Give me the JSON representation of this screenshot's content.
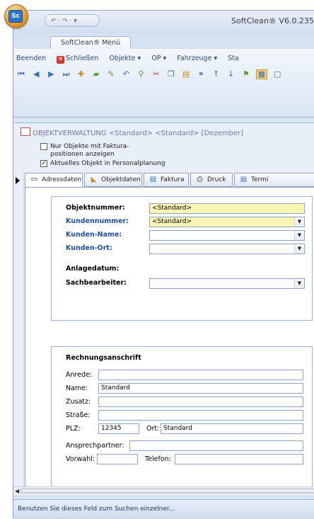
{
  "app": {
    "title": "SoftClean® V6.0.235",
    "quick_access": "↶ · ↷ · ▾",
    "orb_label": "Sc"
  },
  "ribbon": {
    "tab": "SoftClean® Menü",
    "menu": [
      "Beenden",
      "Schließen",
      "Objekte ▾",
      "OP ▾",
      "Fahrzeuge ▾",
      "Sta"
    ]
  },
  "document": {
    "title": "OBJEKTVERWALTUNG  <Standard>  <Standard>  [Dezember]",
    "checkbox1_line1": "Nur Objekte mit Faktura-",
    "checkbox1_line2": "positionen anzeigen",
    "checkbox1_checked": false,
    "checkbox2": "Aktuelles Objekt in Personalplanung",
    "checkbox2_checked": true
  },
  "tabs": [
    "Adressdaten",
    "Objektdaten",
    "Faktura",
    "Druck",
    "Termi"
  ],
  "form": {
    "objektnummer_label": "Objektnummer:",
    "objektnummer_value": "<Standard>",
    "kundennummer_label": "Kundennummer:",
    "kundennummer_value": "<Standard>",
    "kunden_name_label": "Kunden-Name:",
    "kunden_ort_label": "Kunden-Ort:",
    "anlagedatum_label": "Anlagedatum:",
    "sachbearbeiter_label": "Sachbearbeiter:"
  },
  "billing": {
    "heading": "Rechnungsanschrift",
    "anrede_label": "Anrede:",
    "name_label": "Name:",
    "name_value": "Standard",
    "zusatz_label": "Zusatz:",
    "strasse_label": "Straße:",
    "plz_label": "PLZ:",
    "plz_value": "12345",
    "ort_label": "Ort:",
    "ort_value": "Standard",
    "ansprechpartner_label": "Ansprechpartner:",
    "vorwahl_label": "Vorwahl:",
    "telefon_label": "Telefon:"
  },
  "status": {
    "text": "Benutzen Sie dieses Feld zum Suchen einzelner..."
  }
}
